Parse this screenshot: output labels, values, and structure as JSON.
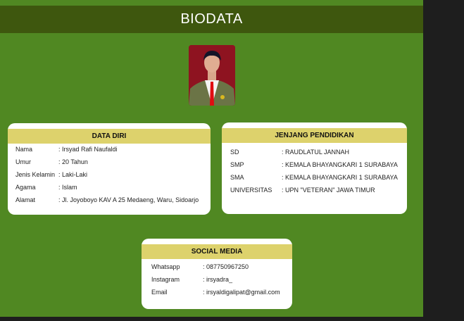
{
  "header": {
    "title": "BIODATA"
  },
  "colors": {
    "background": "#508822",
    "header": "#3e570e",
    "card_header": "#ddd26c",
    "outside": "#1e1e1e"
  },
  "data_diri": {
    "title": "DATA DIRI",
    "rows": [
      {
        "label": "Nama",
        "value": ": Irsyad Rafi Naufaldi"
      },
      {
        "label": "Umur",
        "value": ": 20 Tahun"
      },
      {
        "label": "Jenis Kelamin",
        "value": ": Laki-Laki"
      },
      {
        "label": "Agama",
        "value": ": Islam"
      },
      {
        "label": "Alamat",
        "value": ": Jl. Joyoboyo KAV A 25 Medaeng, Waru, Sidoarjo"
      }
    ]
  },
  "pendidikan": {
    "title": "JENJANG PENDIDIKAN",
    "rows": [
      {
        "label": "SD",
        "value": ":  RAUDLATUL JANNAH"
      },
      {
        "label": "SMP",
        "value": ":  KEMALA BHAYANGKARI 1 SURABAYA"
      },
      {
        "label": "SMA",
        "value": ":  KEMALA BHAYANGKARI 1 SURABAYA"
      },
      {
        "label": "UNIVERSITAS",
        "value": ":  UPN \"VETERAN\" JAWA TIMUR"
      }
    ]
  },
  "social": {
    "title": "SOCIAL MEDIA",
    "rows": [
      {
        "label": "Whatsapp",
        "value": ":  087750967250"
      },
      {
        "label": "Instagram",
        "value": ":  irsyadra_"
      },
      {
        "label": "Email",
        "value": ":  irsyaldigalipat@gmail.com"
      }
    ]
  }
}
